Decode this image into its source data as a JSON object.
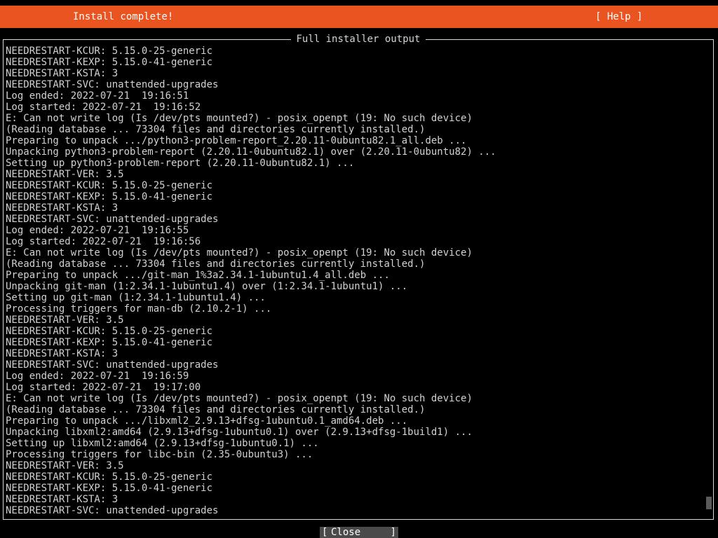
{
  "header": {
    "title": "Install complete!",
    "help_label": "[ Help ]",
    "accent_color": "#e95420"
  },
  "output_panel": {
    "title": "Full installer output",
    "scroll_position": 0.985,
    "lines": [
      "NEEDRESTART-KCUR: 5.15.0-25-generic",
      "NEEDRESTART-KEXP: 5.15.0-41-generic",
      "NEEDRESTART-KSTA: 3",
      "NEEDRESTART-SVC: unattended-upgrades",
      "Log ended: 2022-07-21  19:16:51",
      "Log started: 2022-07-21  19:16:52",
      "E: Can not write log (Is /dev/pts mounted?) - posix_openpt (19: No such device)",
      "(Reading database ... 73304 files and directories currently installed.)",
      "Preparing to unpack .../python3-problem-report_2.20.11-0ubuntu82.1_all.deb ...",
      "Unpacking python3-problem-report (2.20.11-0ubuntu82.1) over (2.20.11-0ubuntu82) ...",
      "Setting up python3-problem-report (2.20.11-0ubuntu82.1) ...",
      "NEEDRESTART-VER: 3.5",
      "NEEDRESTART-KCUR: 5.15.0-25-generic",
      "NEEDRESTART-KEXP: 5.15.0-41-generic",
      "NEEDRESTART-KSTA: 3",
      "NEEDRESTART-SVC: unattended-upgrades",
      "Log ended: 2022-07-21  19:16:55",
      "Log started: 2022-07-21  19:16:56",
      "E: Can not write log (Is /dev/pts mounted?) - posix_openpt (19: No such device)",
      "(Reading database ... 73304 files and directories currently installed.)",
      "Preparing to unpack .../git-man_1%3a2.34.1-1ubuntu1.4_all.deb ...",
      "Unpacking git-man (1:2.34.1-1ubuntu1.4) over (1:2.34.1-1ubuntu1) ...",
      "Setting up git-man (1:2.34.1-1ubuntu1.4) ...",
      "Processing triggers for man-db (2.10.2-1) ...",
      "NEEDRESTART-VER: 3.5",
      "NEEDRESTART-KCUR: 5.15.0-25-generic",
      "NEEDRESTART-KEXP: 5.15.0-41-generic",
      "NEEDRESTART-KSTA: 3",
      "NEEDRESTART-SVC: unattended-upgrades",
      "Log ended: 2022-07-21  19:16:59",
      "Log started: 2022-07-21  19:17:00",
      "E: Can not write log (Is /dev/pts mounted?) - posix_openpt (19: No such device)",
      "(Reading database ... 73304 files and directories currently installed.)",
      "Preparing to unpack .../libxml2_2.9.13+dfsg-1ubuntu0.1_amd64.deb ...",
      "Unpacking libxml2:amd64 (2.9.13+dfsg-1ubuntu0.1) over (2.9.13+dfsg-1build1) ...",
      "Setting up libxml2:amd64 (2.9.13+dfsg-1ubuntu0.1) ...",
      "Processing triggers for libc-bin (2.35-0ubuntu3) ...",
      "NEEDRESTART-VER: 3.5",
      "NEEDRESTART-KCUR: 5.15.0-25-generic",
      "NEEDRESTART-KEXP: 5.15.0-41-generic",
      "NEEDRESTART-KSTA: 3",
      "NEEDRESTART-SVC: unattended-upgrades"
    ]
  },
  "footer": {
    "close_open": "[",
    "close_label": "Close",
    "close_end": "]"
  }
}
